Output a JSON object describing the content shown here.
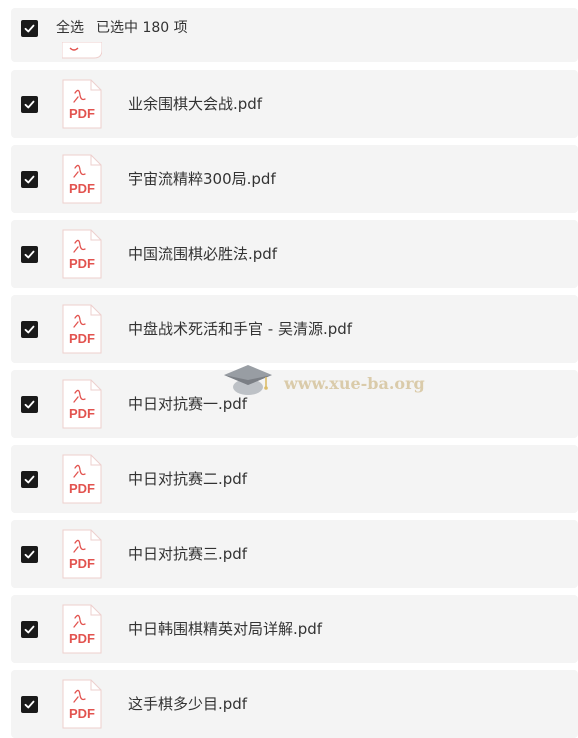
{
  "header": {
    "select_all_label": "全选",
    "selection_summary": "已选中  180  项",
    "all_checked": true
  },
  "files": [
    {
      "name": "业余围棋大会战.pdf",
      "checked": true,
      "icon": "pdf-file-icon"
    },
    {
      "name": "宇宙流精粹300局.pdf",
      "checked": true,
      "icon": "pdf-file-icon"
    },
    {
      "name": "中国流围棋必胜法.pdf",
      "checked": true,
      "icon": "pdf-file-icon"
    },
    {
      "name": "中盘战术死活和手官 - 吴清源.pdf",
      "checked": true,
      "icon": "pdf-file-icon"
    },
    {
      "name": "中日对抗赛一.pdf",
      "checked": true,
      "icon": "pdf-file-icon"
    },
    {
      "name": "中日对抗赛二.pdf",
      "checked": true,
      "icon": "pdf-file-icon"
    },
    {
      "name": "中日对抗赛三.pdf",
      "checked": true,
      "icon": "pdf-file-icon"
    },
    {
      "name": "中日韩围棋精英对局详解.pdf",
      "checked": true,
      "icon": "pdf-file-icon"
    },
    {
      "name": "这手棋多少目.pdf",
      "checked": true,
      "icon": "pdf-file-icon"
    }
  ],
  "watermark": {
    "text": "www.xue-ba.org",
    "icon": "graduation-cap-icon"
  },
  "colors": {
    "row_background": "#f4f4f4",
    "checkbox": "#1a1a1a",
    "pdf_red": "#e2534f",
    "text": "#333333"
  }
}
